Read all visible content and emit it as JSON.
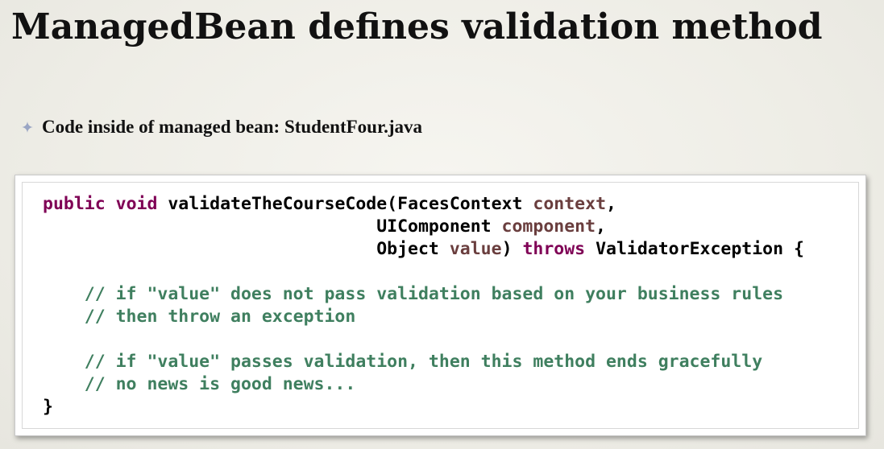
{
  "slide": {
    "title": "ManagedBean defines validation method",
    "bullet": {
      "icon": "four-point-star-bullet-icon",
      "text": "Code inside of managed bean: StudentFour.java"
    }
  },
  "code": {
    "colors": {
      "keyword": "#7f0055",
      "parameter": "#6a3e3e",
      "comment": "#3f7f5f",
      "plain": "#000000"
    },
    "lines": [
      [
        {
          "t": "public",
          "k": "kw"
        },
        {
          "t": " ",
          "k": "plain"
        },
        {
          "t": "void",
          "k": "kw"
        },
        {
          "t": " validateTheCourseCode(FacesContext ",
          "k": "plain"
        },
        {
          "t": "context",
          "k": "param"
        },
        {
          "t": ",",
          "k": "plain"
        }
      ],
      [
        {
          "t": "                                UIComponent ",
          "k": "plain"
        },
        {
          "t": "component",
          "k": "param"
        },
        {
          "t": ",",
          "k": "plain"
        }
      ],
      [
        {
          "t": "                                Object ",
          "k": "plain"
        },
        {
          "t": "value",
          "k": "param"
        },
        {
          "t": ") ",
          "k": "plain"
        },
        {
          "t": "throws",
          "k": "kw"
        },
        {
          "t": " ValidatorException {",
          "k": "plain"
        }
      ],
      [],
      [
        {
          "t": "    // if \"value\" does not pass validation based on your business rules",
          "k": "comment"
        }
      ],
      [
        {
          "t": "    // then throw an exception",
          "k": "comment"
        }
      ],
      [],
      [
        {
          "t": "    // if \"value\" passes validation, then this method ends gracefully",
          "k": "comment"
        }
      ],
      [
        {
          "t": "    // no news is good news...",
          "k": "comment"
        }
      ],
      [
        {
          "t": "}",
          "k": "plain"
        }
      ]
    ]
  }
}
